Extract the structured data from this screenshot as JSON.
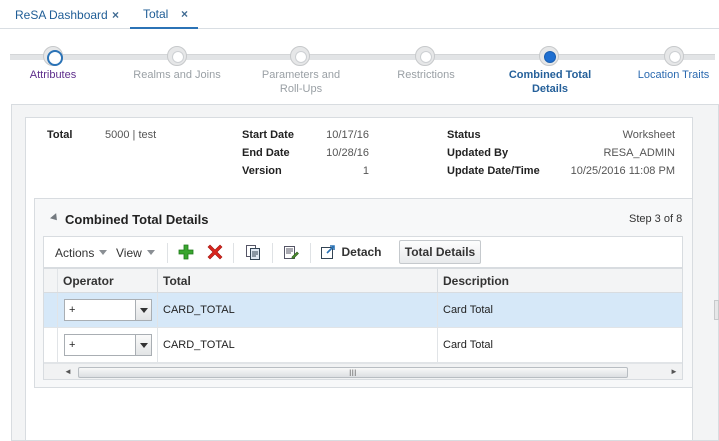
{
  "tabs": [
    {
      "label": "ReSA Dashboard",
      "close": "×"
    },
    {
      "label": "Total",
      "close": "×"
    }
  ],
  "train": {
    "stops": [
      {
        "label": "Attributes",
        "state": "visited"
      },
      {
        "label": "Realms and Joins",
        "state": "unvisited"
      },
      {
        "label": "Parameters and Roll-Ups",
        "state": "unvisited"
      },
      {
        "label": "Restrictions",
        "state": "unvisited"
      },
      {
        "label": "Combined Total Details",
        "state": "current"
      },
      {
        "label": "Location Traits",
        "state": "next"
      }
    ]
  },
  "summary": {
    "total_label": "Total",
    "total_value": "5000 | test",
    "start_date_label": "Start Date",
    "start_date": "10/17/16",
    "end_date_label": "End Date",
    "end_date": "10/28/16",
    "version_label": "Version",
    "version": "1",
    "status_label": "Status",
    "status": "Worksheet",
    "updated_by_label": "Updated By",
    "updated_by": "RESA_ADMIN",
    "update_dt_label": "Update Date/Time",
    "update_dt": "10/25/2016 11:08 PM"
  },
  "section": {
    "title": "Combined Total Details",
    "step": "Step 3 of 8"
  },
  "toolbar": {
    "actions_label": "Actions",
    "view_label": "View",
    "add_icon": "add-icon",
    "delete_icon": "delete-icon",
    "copy_icon": "copy-icon",
    "edit_icon": "edit-icon",
    "detach_label": "Detach",
    "total_details_label": "Total Details"
  },
  "table": {
    "columns": [
      "Operator",
      "Total",
      "Description"
    ],
    "rows": [
      {
        "operator": "+",
        "total": "CARD_TOTAL",
        "description": "Card Total",
        "selected": true
      },
      {
        "operator": "+",
        "total": "CARD_TOTAL",
        "description": "Card Total",
        "selected": false
      }
    ]
  },
  "scroll": {
    "grip": "III",
    "left_arrow": "◄",
    "right_arrow": "►"
  },
  "colors": {
    "accent": "#2b73b6",
    "current_stop": "#1f6fd1",
    "visited_label": "#5e2e8c",
    "selected_row": "#d6e8f8"
  }
}
